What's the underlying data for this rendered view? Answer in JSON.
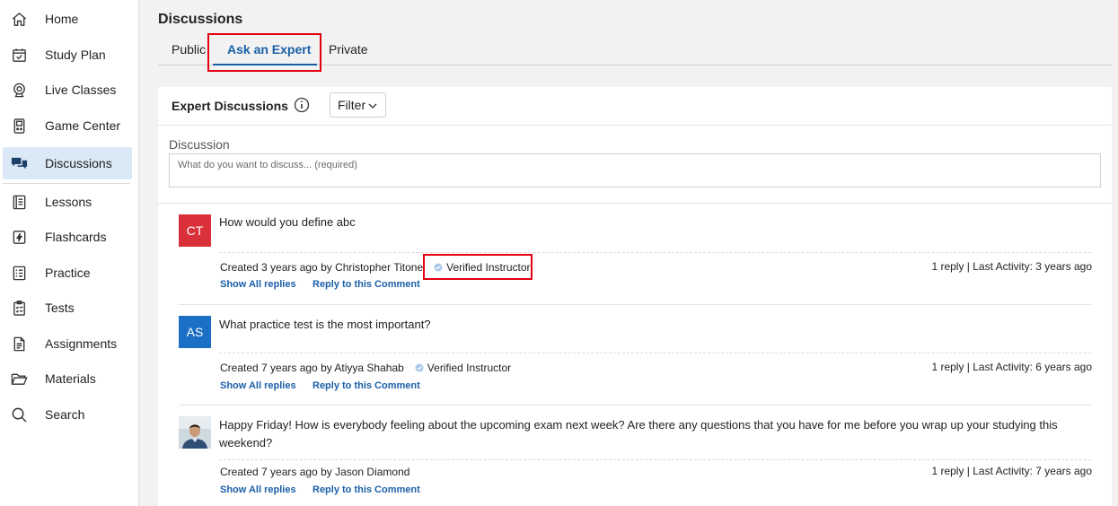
{
  "sidebar": {
    "items": [
      {
        "label": "Home",
        "icon": "home-icon"
      },
      {
        "label": "Study Plan",
        "icon": "calendar-check-icon"
      },
      {
        "label": "Live Classes",
        "icon": "webcam-icon"
      },
      {
        "label": "Game Center",
        "icon": "game-console-icon"
      },
      {
        "label": "Discussions",
        "icon": "chat-bubbles-icon",
        "active": true
      },
      {
        "label": "Lessons",
        "icon": "book-icon"
      },
      {
        "label": "Flashcards",
        "icon": "flashcard-icon"
      },
      {
        "label": "Practice",
        "icon": "list-icon"
      },
      {
        "label": "Tests",
        "icon": "clipboard-icon"
      },
      {
        "label": "Assignments",
        "icon": "document-icon"
      },
      {
        "label": "Materials",
        "icon": "folder-icon"
      },
      {
        "label": "Search",
        "icon": "search-icon"
      }
    ]
  },
  "page": {
    "title": "Discussions"
  },
  "tabs": [
    {
      "label": "Public"
    },
    {
      "label": "Ask an Expert",
      "active": true
    },
    {
      "label": "Private"
    }
  ],
  "panel": {
    "title": "Expert Discussions",
    "filter_label": "Filter",
    "discussion_label": "Discussion",
    "discussion_placeholder": "What do you want to discuss... (required)"
  },
  "comments": [
    {
      "avatar_initials": "CT",
      "avatar_color": "#d9303a",
      "text": "How would you define abc",
      "meta": "Created 3 years ago by Christopher Titone",
      "badge": "Verified Instructor",
      "activity": "1 reply | Last Activity: 3 years ago",
      "show_replies": "Show All replies",
      "reply": "Reply to this Comment"
    },
    {
      "avatar_initials": "AS",
      "avatar_color": "#1b6fc5",
      "text": "What practice test is the most important?",
      "meta": "Created 7 years ago by Atiyya Shahab",
      "badge": "Verified Instructor",
      "activity": "1 reply | Last Activity: 6 years ago",
      "show_replies": "Show All replies",
      "reply": "Reply to this Comment"
    },
    {
      "avatar_initials": "",
      "text": "Happy Friday! How is everybody feeling about the upcoming exam next week? Are there any questions that you have for me before you wrap up your studying this weekend?",
      "meta": "Created 7 years ago by Jason Diamond",
      "activity": "1 reply | Last Activity: 7 years ago",
      "show_replies": "Show All replies",
      "reply": "Reply to this Comment"
    }
  ],
  "colors": {
    "accent": "#1a5fa8",
    "highlight": "#e3000f",
    "active_nav_bg": "#dbe9f7",
    "verified_check": "#a8c8ea"
  }
}
